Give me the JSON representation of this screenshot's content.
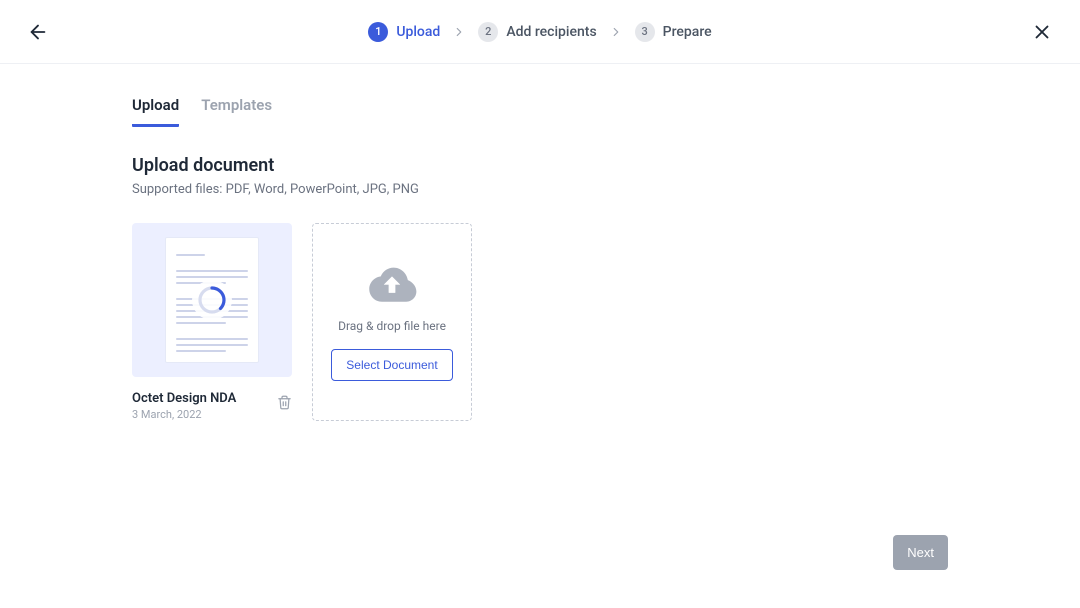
{
  "header": {
    "steps": [
      {
        "num": "1",
        "label": "Upload",
        "active": true
      },
      {
        "num": "2",
        "label": "Add recipients",
        "active": false
      },
      {
        "num": "3",
        "label": "Prepare",
        "active": false
      }
    ]
  },
  "tabs": [
    {
      "label": "Upload",
      "active": true
    },
    {
      "label": "Templates",
      "active": false
    }
  ],
  "section": {
    "title": "Upload document",
    "subtitle": "Supported files: PDF, Word, PowerPoint, JPG, PNG"
  },
  "uploaded": [
    {
      "name": "Octet Design NDA",
      "date": "3 March, 2022"
    }
  ],
  "dropzone": {
    "text": "Drag & drop file here",
    "button": "Select Document"
  },
  "footer": {
    "next": "Next"
  }
}
